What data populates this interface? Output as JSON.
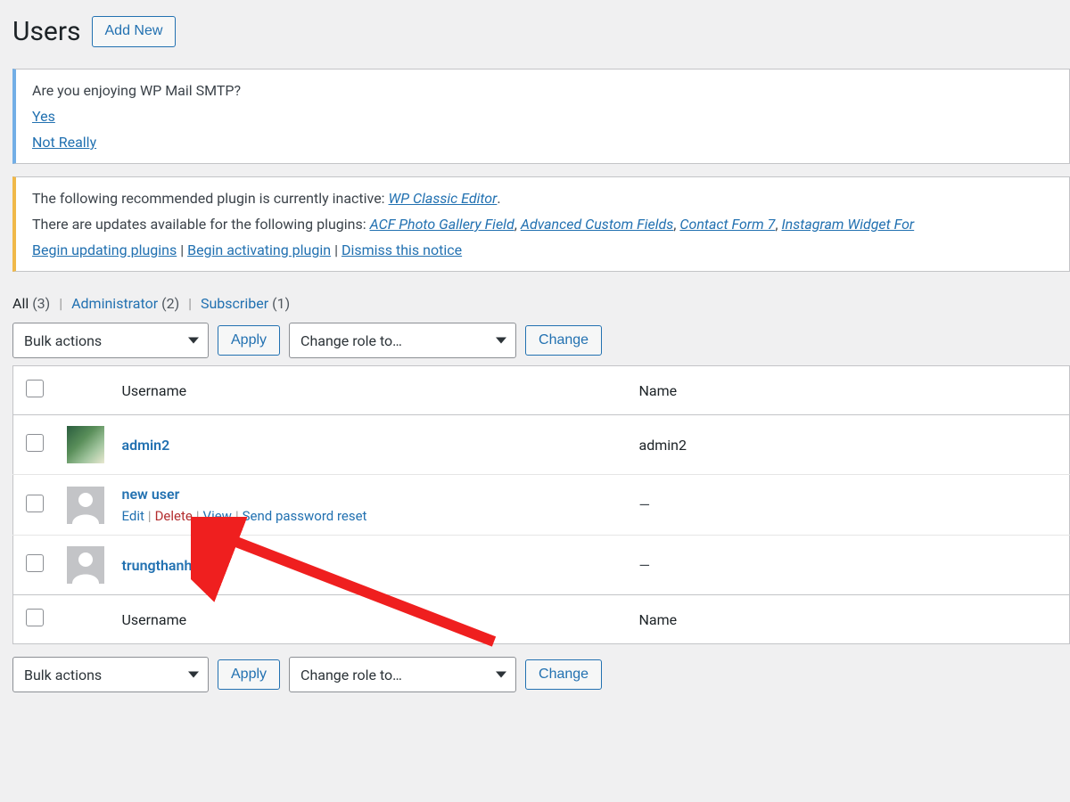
{
  "header": {
    "title": "Users",
    "add_new": "Add New"
  },
  "notice_smtp": {
    "question": "Are you enjoying WP Mail SMTP?",
    "yes": "Yes",
    "no": "Not Really"
  },
  "notice_plugins": {
    "inactive_prefix": "The following recommended plugin is currently inactive: ",
    "inactive_plugin": "WP Classic Editor",
    "inactive_suffix": ".",
    "updates_prefix": "There are updates available for the following plugins: ",
    "plugins": [
      "ACF Photo Gallery Field",
      "Advanced Custom Fields",
      "Contact Form 7",
      "Instagram Widget For"
    ],
    "begin_update": "Begin updating plugins",
    "begin_activate": "Begin activating plugin",
    "dismiss": "Dismiss this notice"
  },
  "filters": {
    "all_label": "All",
    "all_count": "(3)",
    "admin_label": "Administrator",
    "admin_count": "(2)",
    "sub_label": "Subscriber",
    "sub_count": "(1)"
  },
  "controls": {
    "bulk": "Bulk actions",
    "apply": "Apply",
    "role": "Change role to…",
    "change": "Change"
  },
  "columns": {
    "username": "Username",
    "name": "Name"
  },
  "rows": [
    {
      "username": "admin2",
      "name": "admin2",
      "avatar": "photo",
      "actions": false
    },
    {
      "username": "new user",
      "name": "—",
      "avatar": "default",
      "actions": true
    },
    {
      "username": "trungthanh",
      "name": "—",
      "avatar": "default",
      "actions": false
    }
  ],
  "row_actions": {
    "edit": "Edit",
    "delete": "Delete",
    "view": "View",
    "reset": "Send password reset"
  }
}
